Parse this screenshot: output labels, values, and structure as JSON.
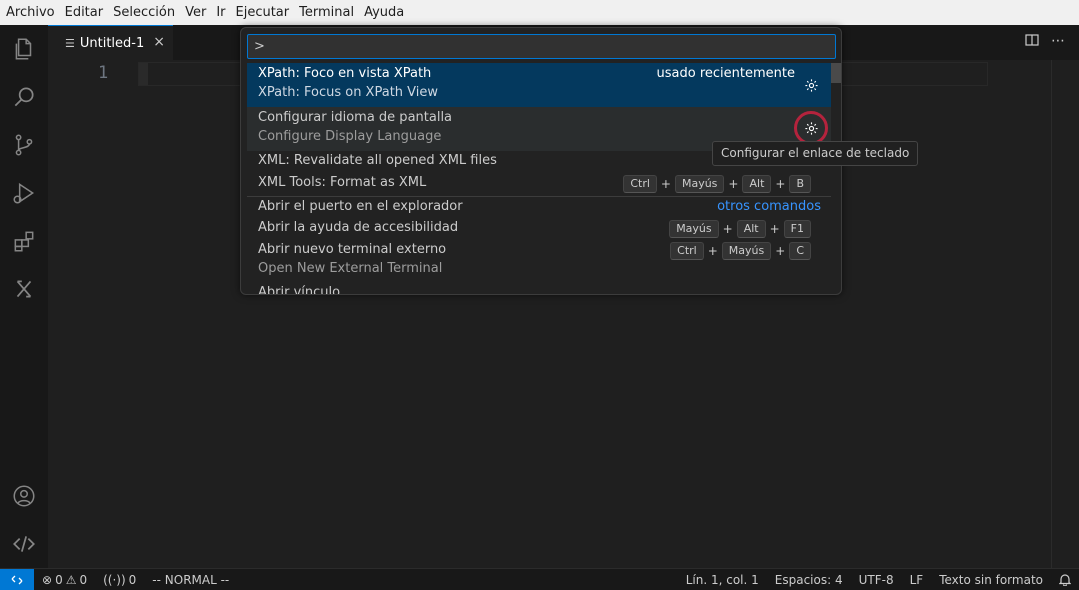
{
  "menu": [
    "Archivo",
    "Editar",
    "Selección",
    "Ver",
    "Ir",
    "Ejecutar",
    "Terminal",
    "Ayuda"
  ],
  "tab": {
    "name": "Untitled-1",
    "close": "×"
  },
  "editor": {
    "line_number": "1"
  },
  "quick_pick": {
    "input_value": ">",
    "items": [
      {
        "label": "XPath: Foco en vista XPath",
        "detail": "XPath: Focus on XPath View",
        "badge": "usado recientemente"
      },
      {
        "label": "Configurar idioma de pantalla",
        "detail": "Configure Display Language"
      },
      {
        "label": "XML: Revalidate all opened XML files"
      },
      {
        "label": "XML Tools: Format as XML",
        "keys": [
          "Ctrl",
          "Mayús",
          "Alt",
          "B"
        ]
      },
      {
        "label": "Abrir el puerto en el explorador",
        "badge": "otros comandos"
      },
      {
        "label": "Abrir la ayuda de accesibilidad",
        "keys": [
          "Mayús",
          "Alt",
          "F1"
        ]
      },
      {
        "label": "Abrir nuevo terminal externo",
        "detail": "Open New External Terminal",
        "keys": [
          "Ctrl",
          "Mayús",
          "C"
        ]
      },
      {
        "label": "Abrir vínculo"
      }
    ]
  },
  "tooltip": "Configurar el enlace de teclado",
  "status": {
    "errors": "0",
    "warnings": "0",
    "ports": "0",
    "mode": "-- NORMAL --",
    "position": "Lín. 1, col. 1",
    "spaces": "Espacios: 4",
    "encoding": "UTF-8",
    "eol": "LF",
    "language": "Texto sin formato"
  },
  "colors": {
    "accent": "#0078d4",
    "active_row": "#04395e",
    "focus_ring": "#b4233d",
    "link": "#3794ff"
  }
}
